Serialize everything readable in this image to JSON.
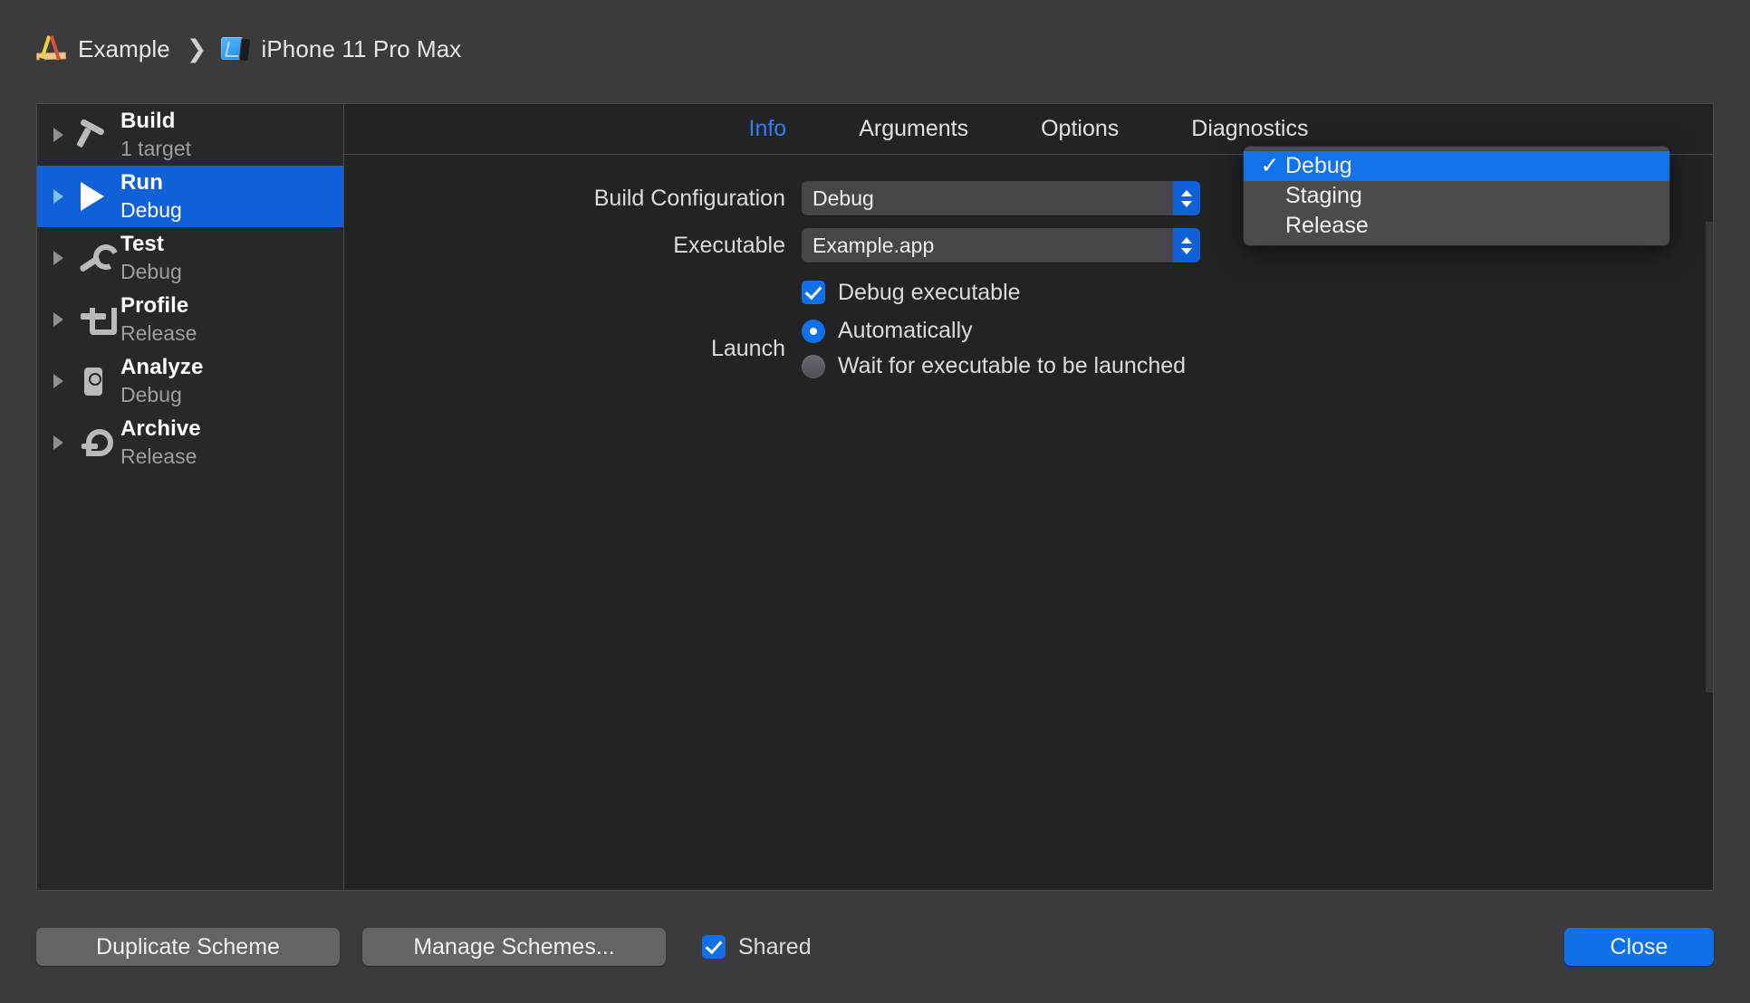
{
  "breadcrumb": {
    "project": "Example",
    "separator": "❯",
    "destination": "iPhone 11 Pro Max",
    "project_icon": "xcode-app-icon",
    "destination_icon": "simulator-icon"
  },
  "sidebar": {
    "items": [
      {
        "name": "Build",
        "sub": "1 target",
        "icon": "hammer-icon",
        "selected": false
      },
      {
        "name": "Run",
        "sub": "Debug",
        "icon": "play-icon",
        "selected": true
      },
      {
        "name": "Test",
        "sub": "Debug",
        "icon": "wrench-icon",
        "selected": false
      },
      {
        "name": "Profile",
        "sub": "Release",
        "icon": "caliper-icon",
        "selected": false
      },
      {
        "name": "Analyze",
        "sub": "Debug",
        "icon": "analyze-icon",
        "selected": false
      },
      {
        "name": "Archive",
        "sub": "Release",
        "icon": "archive-icon",
        "selected": false
      }
    ]
  },
  "tabs": [
    {
      "label": "Info",
      "active": true
    },
    {
      "label": "Arguments",
      "active": false
    },
    {
      "label": "Options",
      "active": false
    },
    {
      "label": "Diagnostics",
      "active": false
    }
  ],
  "form": {
    "build_configuration_label": "Build Configuration",
    "build_configuration_value": "Debug",
    "executable_label": "Executable",
    "executable_value": "Example.app",
    "debug_executable_label": "Debug executable",
    "debug_executable_checked": true,
    "launch_label": "Launch",
    "launch_options": [
      {
        "label": "Automatically",
        "selected": true
      },
      {
        "label": "Wait for executable to be launched",
        "selected": false
      }
    ]
  },
  "menu": {
    "open": true,
    "check_glyph": "✓",
    "items": [
      {
        "label": "Debug",
        "checked": true,
        "highlighted": true
      },
      {
        "label": "Staging",
        "checked": false,
        "highlighted": false
      },
      {
        "label": "Release",
        "checked": false,
        "highlighted": false
      }
    ]
  },
  "bottom": {
    "duplicate_scheme": "Duplicate Scheme",
    "manage_schemes": "Manage Schemes...",
    "shared_label": "Shared",
    "shared_checked": true,
    "close": "Close"
  },
  "colors": {
    "accent_blue": "#1061d8",
    "menu_highlight": "#1272ec",
    "tab_active": "#2f7ff0",
    "window_bg": "#3b3b3d",
    "panel_bg": "#232326",
    "sidebar_bg": "#28282b"
  }
}
